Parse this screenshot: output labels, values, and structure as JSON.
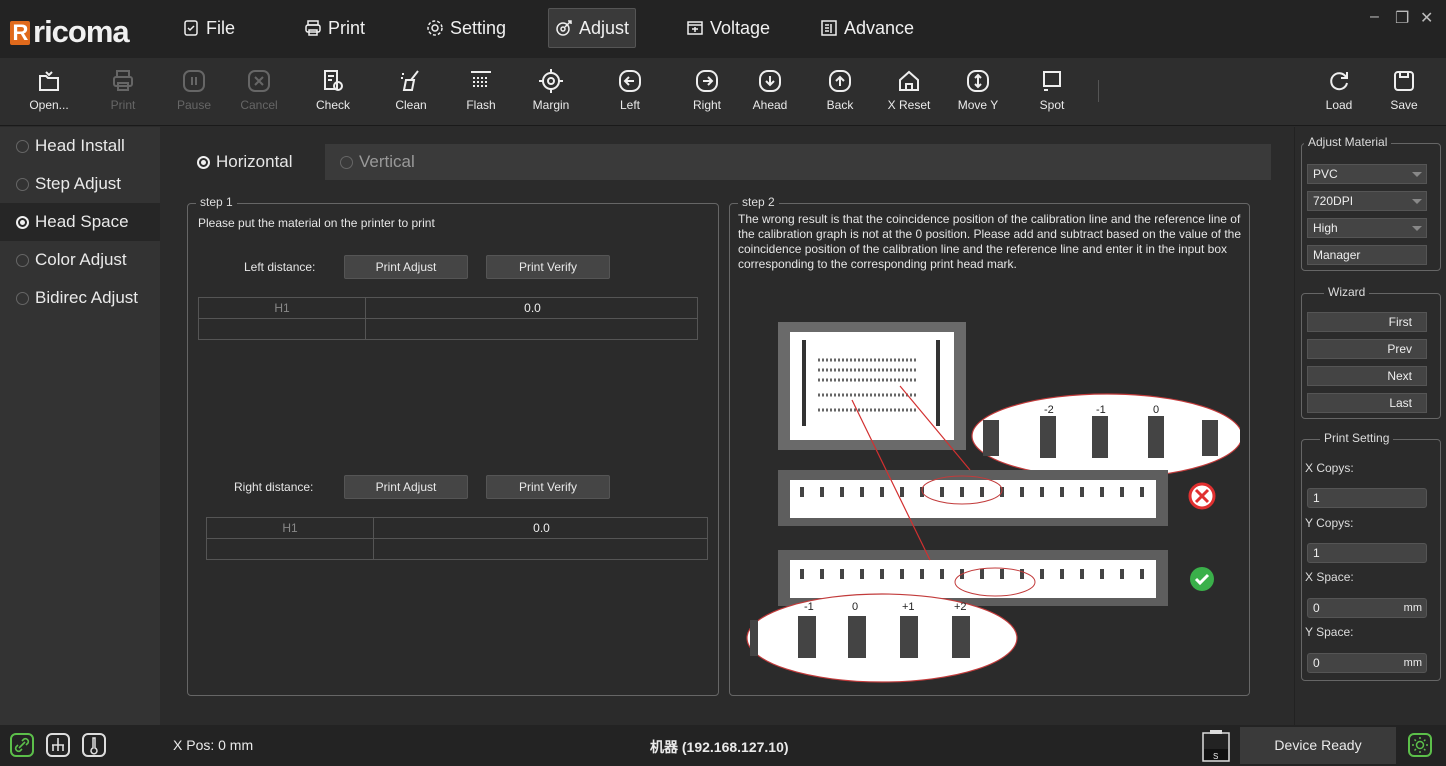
{
  "app": {
    "logo_text": "ricoma"
  },
  "menu": {
    "file": "File",
    "print": "Print",
    "setting": "Setting",
    "adjust": "Adjust",
    "voltage": "Voltage",
    "advance": "Advance"
  },
  "window_controls": {
    "minimize": "–",
    "restore": "❐",
    "close": "✕"
  },
  "toolbar": {
    "open": "Open...",
    "print": "Print",
    "pause": "Pause",
    "cancel": "Cancel",
    "check": "Check",
    "clean": "Clean",
    "flash": "Flash",
    "margin": "Margin",
    "left": "Left",
    "right": "Right",
    "ahead": "Ahead",
    "back": "Back",
    "x_reset": "X Reset",
    "move_y": "Move Y",
    "spot": "Spot",
    "load": "Load",
    "save": "Save"
  },
  "sidebar": {
    "items": [
      {
        "label": "Head Install"
      },
      {
        "label": "Step Adjust"
      },
      {
        "label": "Head Space"
      },
      {
        "label": "Color Adjust"
      },
      {
        "label": "Bidirec Adjust"
      }
    ]
  },
  "tabs": {
    "horizontal": "Horizontal",
    "vertical": "Vertical"
  },
  "step1": {
    "title": "step 1",
    "instruction": "Please put the material on the printer to print",
    "left_label": "Left distance:",
    "right_label": "Right distance:",
    "print_adjust": "Print Adjust",
    "print_verify": "Print Verify",
    "left_table": {
      "head": "H1",
      "value": "0.0"
    },
    "right_table": {
      "head": "H1",
      "value": "0.0"
    }
  },
  "step2": {
    "title": "step 2",
    "text": "The wrong result is that the coincidence position of the calibration line and the reference line of the calibration graph is not at the 0 position. Please add and subtract based on the value of the coincidence position of the calibration line and the reference line and enter it in the input box corresponding to the corresponding print head mark.",
    "top_scale": [
      "-2",
      "-1",
      "0"
    ],
    "bottom_scale": [
      "-1",
      "0",
      "+1",
      "+2"
    ]
  },
  "right_panel": {
    "adjust_material": "Adjust Material",
    "material": "PVC",
    "dpi": "720DPI",
    "quality": "High",
    "manager": "Manager",
    "wizard": "Wizard",
    "first": "First",
    "prev": "Prev",
    "next": "Next",
    "last": "Last",
    "print_setting": "Print Setting",
    "x_copys_label": "X Copys:",
    "x_copys": "1",
    "y_copys_label": "Y Copys:",
    "y_copys": "1",
    "x_space_label": "X Space:",
    "x_space": "0",
    "y_space_label": "Y Space:",
    "y_space": "0",
    "unit": "mm"
  },
  "status": {
    "xpos": "X Pos: 0 mm",
    "machine": "机器 (192.168.127.10)",
    "device": "Device Ready",
    "ink_label": "S"
  },
  "colors": {
    "accent_orange": "#e06a1c",
    "ok_green": "#3ab04a",
    "error_red": "#e03030"
  }
}
